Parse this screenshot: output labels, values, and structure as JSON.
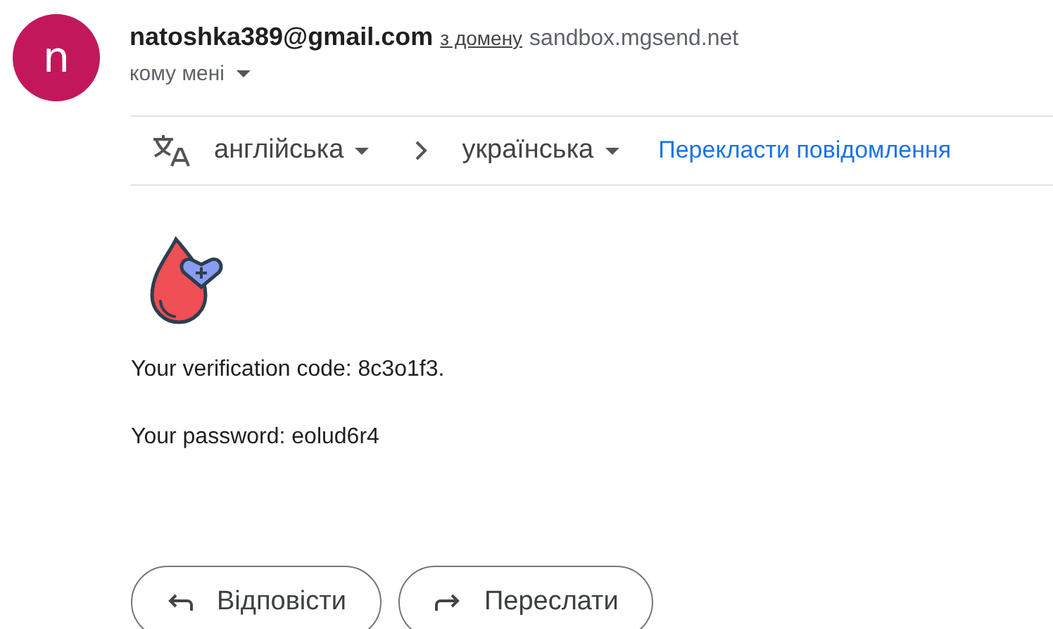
{
  "sender": {
    "avatar_letter": "n",
    "email": "natoshka389@gmail.com",
    "via_label": "з домену",
    "domain": "sandbox.mgsend.net",
    "recipient": "кому мені"
  },
  "translate_bar": {
    "source_language": "англійська",
    "target_language": "українська",
    "action": "Перекласти повідомлення"
  },
  "body": {
    "lines": [
      "Your verification code: 8c3o1f3.",
      "Your password: eolud6r4"
    ]
  },
  "buttons": [
    {
      "kind": "reply",
      "label": "Відповісти"
    },
    {
      "kind": "forward",
      "label": "Переслати"
    }
  ]
}
